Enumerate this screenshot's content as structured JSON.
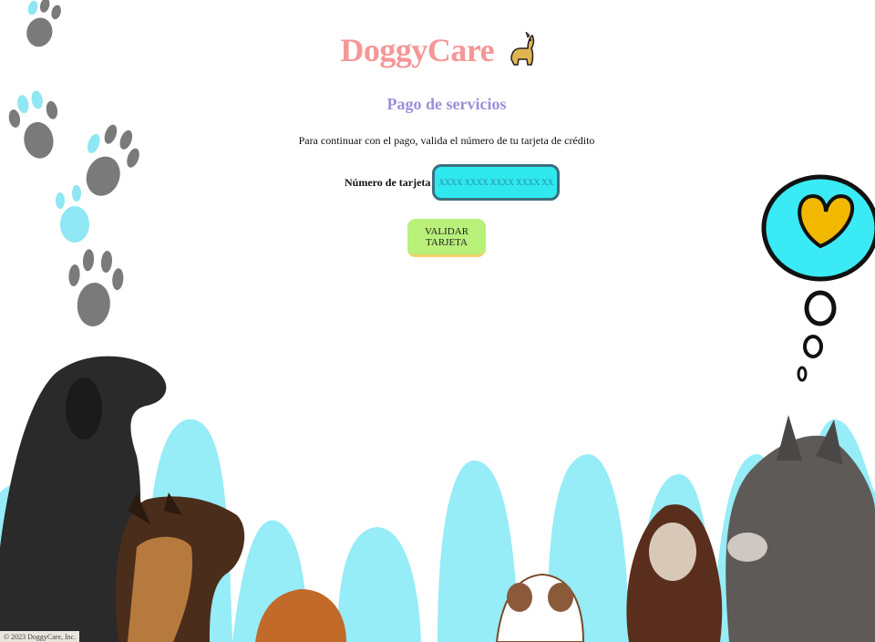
{
  "header": {
    "title": "DoggyCare",
    "logo_icon": "dog-icon"
  },
  "page": {
    "subtitle": "Pago de servicios",
    "instructions": "Para continuar con el pago, valida el número de tu tarjeta de crédito"
  },
  "form": {
    "card_label": "Número de tarjeta",
    "card_placeholder": "XXXX XXXX XXXX XXXX XX",
    "validate_label": "VALIDAR TARJETA"
  },
  "footer": {
    "text": "© 2023 DoggyCare, Inc."
  },
  "colors": {
    "title": "#f59797",
    "subtitle": "#9b8fdc",
    "input_bg": "#2ee8ee",
    "button_bg": "#b8f07a",
    "paw_gray": "#7a7a7a",
    "paw_blue": "#8fe6f4",
    "wave_blue": "#96ecf7",
    "heart": "#f2b800"
  }
}
